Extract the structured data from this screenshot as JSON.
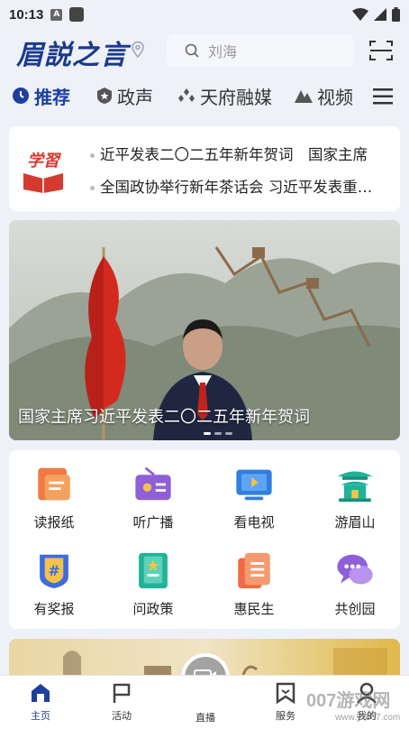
{
  "status": {
    "time": "10:13",
    "a_icon": "A"
  },
  "header": {
    "logo": "眉説之言",
    "search_placeholder": "刘海"
  },
  "nav": {
    "items": [
      {
        "label": "推荐",
        "icon": "clock-icon"
      },
      {
        "label": "政声",
        "icon": "star-shield-icon"
      },
      {
        "label": "天府融媒",
        "icon": "cluster-icon"
      },
      {
        "label": "视频",
        "icon": "mountain-icon"
      }
    ]
  },
  "news": {
    "logo_text": "学習",
    "lines": [
      "近平发表二〇二五年新年贺词　国家主席",
      "全国政协举行新年茶话会 习近平发表重…"
    ]
  },
  "banner": {
    "caption": "国家主席习近平发表二〇二五年新年贺词"
  },
  "grid": {
    "items": [
      {
        "label": "读报纸",
        "color": "#f07a45"
      },
      {
        "label": "听广播",
        "color": "#8f5fd8"
      },
      {
        "label": "看电视",
        "color": "#2e7fe0"
      },
      {
        "label": "游眉山",
        "color": "#1fb39a"
      },
      {
        "label": "有奖报",
        "color": "#3e6be0"
      },
      {
        "label": "问政策",
        "color": "#1fb39a"
      },
      {
        "label": "惠民生",
        "color": "#f06a45"
      },
      {
        "label": "共创园",
        "color": "#8f5fd8"
      }
    ]
  },
  "tabbar": {
    "items": [
      {
        "label": "主页"
      },
      {
        "label": "活动"
      },
      {
        "label": "直播"
      },
      {
        "label": "服务"
      },
      {
        "label": "我的"
      }
    ]
  },
  "watermark": {
    "main": "007游戏网",
    "sub": "www.yx007.com"
  },
  "colors": {
    "accent": "#1d3f9e",
    "background": "#eef1f8"
  }
}
